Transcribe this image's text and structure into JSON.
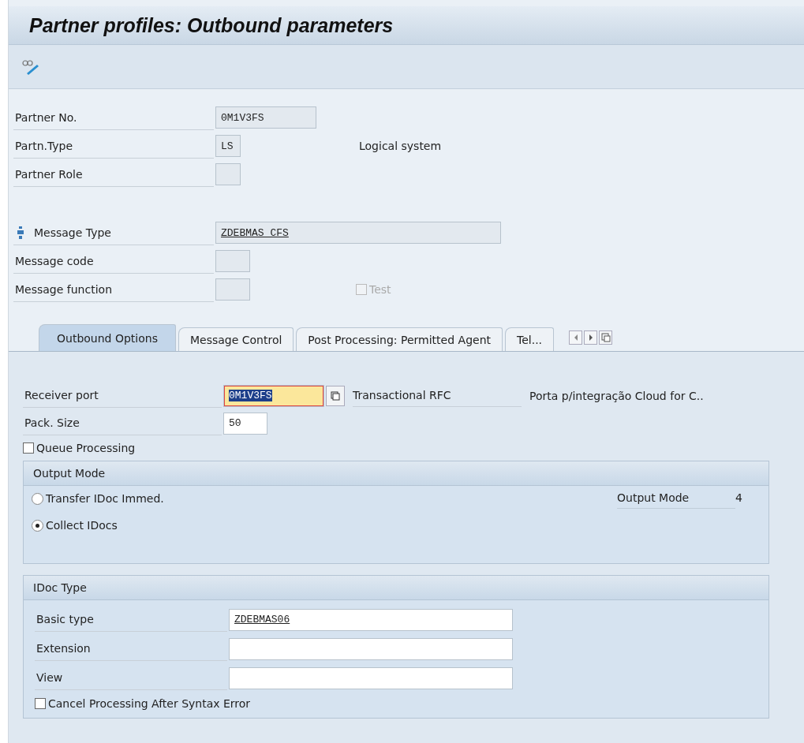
{
  "title": "Partner profiles: Outbound parameters",
  "header_fields": [
    {
      "label": "Partner No.",
      "value": "0M1V3FS"
    },
    {
      "label": "Partn.Type",
      "value": "LS",
      "description": "Logical system"
    },
    {
      "label": "Partner Role"
    }
  ],
  "message_fields": [
    {
      "label": "Message Type",
      "value": "ZDEBMAS_CFS",
      "underlined": true
    },
    {
      "label": "Message code"
    },
    {
      "label": "Message function",
      "checkbox": {
        "label": "Test",
        "checked": false,
        "disabled": true
      }
    }
  ],
  "tabs": [
    {
      "label": "Outbound Options",
      "selected": true
    },
    {
      "label": "Message Control",
      "selected": false
    },
    {
      "label": "Post Processing: Permitted Agent",
      "selected": false
    },
    {
      "label": "Tel...",
      "selected": false
    }
  ],
  "outbound": {
    "receiver_port": {
      "label": "Receiver port",
      "value": "0M1V3FS",
      "focused": true,
      "port_type": "Transactional RFC",
      "description": "Porta p/integração Cloud for C.."
    },
    "pack_size": {
      "label": "Pack. Size",
      "value": "50"
    },
    "queue_processing": {
      "label": "Queue Processing",
      "checked": false
    },
    "output_mode": {
      "title": "Output Mode",
      "options": [
        {
          "label": "Transfer IDoc Immed.",
          "selected": false
        },
        {
          "label": "Collect IDocs",
          "selected": true
        }
      ],
      "mode_label": "Output Mode",
      "mode_value": "4"
    },
    "idoc_type": {
      "title": "IDoc Type",
      "fields": [
        {
          "label": "Basic type",
          "value": "ZDEBMAS06",
          "underlined": true
        },
        {
          "label": "Extension"
        },
        {
          "label": "View"
        }
      ],
      "cancel": {
        "label": "Cancel Processing After Syntax Error",
        "checked": false
      }
    }
  }
}
